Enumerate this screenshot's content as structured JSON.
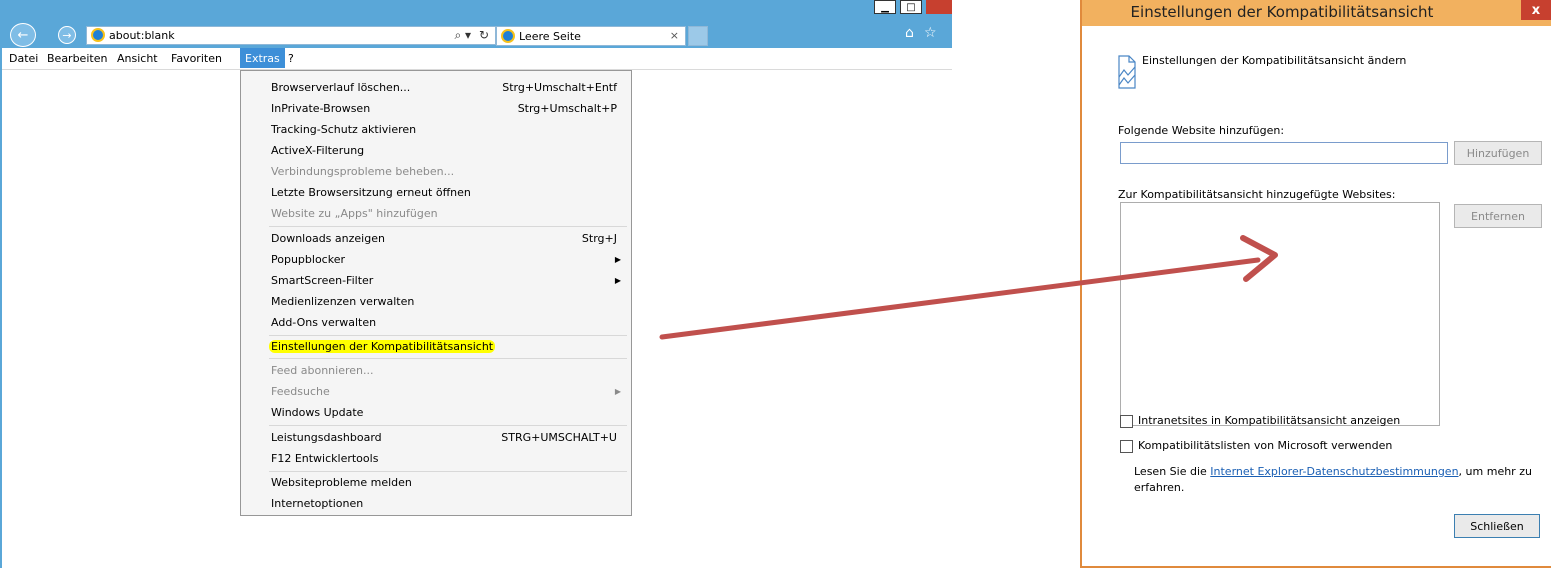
{
  "browser": {
    "address": "about:blank",
    "tab_title": "Leere Seite",
    "tab_close": "×",
    "menubar": [
      "Datei",
      "Bearbeiten",
      "Ansicht",
      "Favoriten",
      "Extras",
      "?"
    ],
    "accent_color": "#5aa7d8"
  },
  "extras_menu": {
    "items": [
      {
        "label": "Browserverlauf löschen...",
        "shortcut": "Strg+Umschalt+Entf"
      },
      {
        "label": "InPrivate-Browsen",
        "shortcut": "Strg+Umschalt+P"
      },
      {
        "label": "Tracking-Schutz aktivieren",
        "shortcut": ""
      },
      {
        "label": "ActiveX-Filterung",
        "shortcut": ""
      },
      {
        "label": "Verbindungsprobleme beheben...",
        "shortcut": "",
        "disabled": true
      },
      {
        "label": "Letzte Browsersitzung erneut öffnen",
        "shortcut": ""
      },
      {
        "label": "Website zu „Apps\" hinzufügen",
        "shortcut": "",
        "disabled": true
      },
      {
        "label": "Downloads anzeigen",
        "shortcut": "Strg+J"
      },
      {
        "label": "Popupblocker",
        "shortcut": "",
        "submenu": true
      },
      {
        "label": "SmartScreen-Filter",
        "shortcut": "",
        "submenu": true
      },
      {
        "label": "Medienlizenzen verwalten",
        "shortcut": ""
      },
      {
        "label": "Add-Ons verwalten",
        "shortcut": ""
      },
      {
        "label": "Einstellungen der Kompatibilitätsansicht",
        "shortcut": "",
        "highlighted": true
      },
      {
        "label": "Feed abonnieren...",
        "shortcut": "",
        "disabled": true
      },
      {
        "label": "Feedsuche",
        "shortcut": "",
        "disabled": true,
        "submenu": true
      },
      {
        "label": "Windows Update",
        "shortcut": ""
      },
      {
        "label": "Leistungsdashboard",
        "shortcut": "STRG+UMSCHALT+U"
      },
      {
        "label": "F12 Entwicklertools",
        "shortcut": ""
      },
      {
        "label": "Websiteprobleme melden",
        "shortcut": ""
      },
      {
        "label": "Internetoptionen",
        "shortcut": ""
      }
    ],
    "highlight_color": "#ffff00"
  },
  "dialog": {
    "title": "Einstellungen der Kompatibilitätsansicht",
    "close": "x",
    "header": "Einstellungen der Kompatibilitätsansicht ändern",
    "add_label": "Folgende Website hinzufügen:",
    "add_value": "",
    "add_button": "Hinzufügen",
    "list_label": "Zur Kompatibilitätsansicht hinzugefügte Websites:",
    "remove_button": "Entfernen",
    "check1": "Intranetsites in Kompatibilitätsansicht anzeigen",
    "check2": "Kompatibilitätslisten von Microsoft verwenden",
    "privacy_prefix": "Lesen Sie die ",
    "privacy_link": "Internet Explorer-Datenschutzbestimmungen",
    "privacy_suffix": ", um mehr zu erfahren.",
    "close_button": "Schließen",
    "title_color": "#f2b15f"
  },
  "annotation": {
    "arrow_color": "#c0504d"
  }
}
